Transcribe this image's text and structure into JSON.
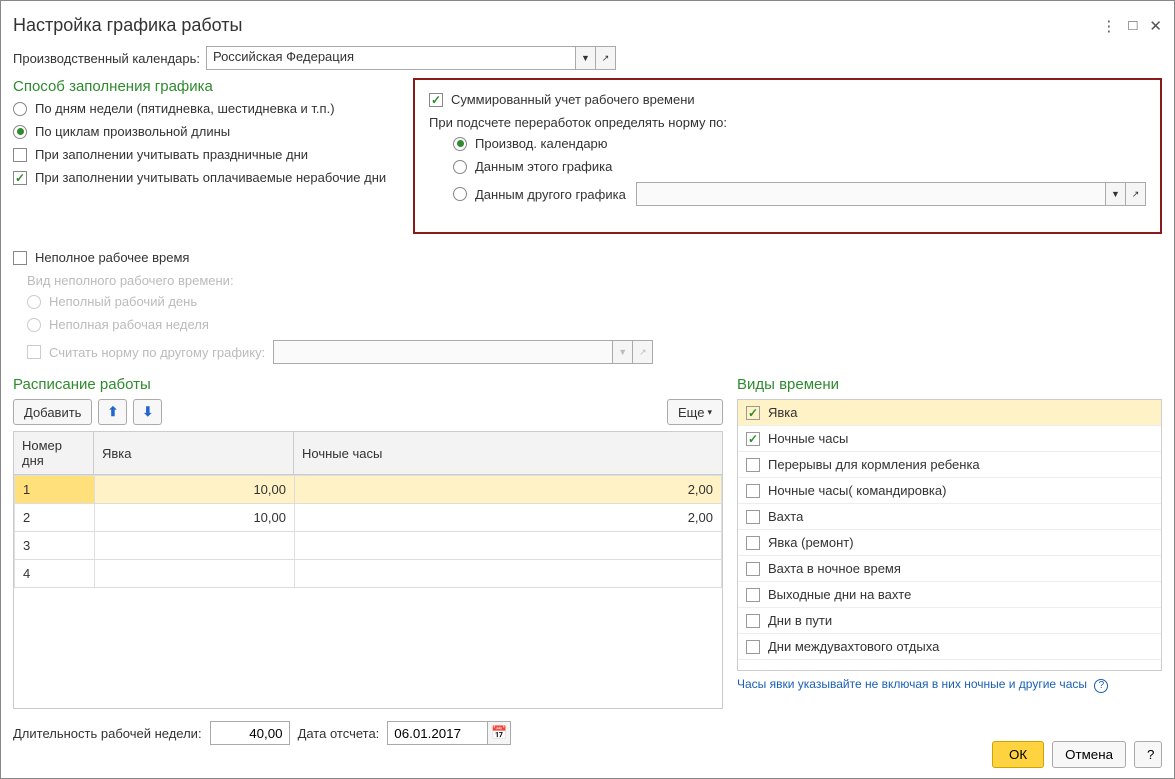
{
  "title": "Настройка графика работы",
  "winbtns": {
    "more": "⋮",
    "max": "□",
    "close": "✕"
  },
  "calendar": {
    "label": "Производственный календарь:",
    "value": "Российская Федерация"
  },
  "fillMethod": {
    "title": "Способ заполнения графика",
    "r1": "По дням недели (пятидневка, шестидневка и т.п.)",
    "r2": "По циклам произвольной длины",
    "c1": "При заполнении учитывать праздничные дни",
    "c2": "При заполнении учитывать оплачиваемые нерабочие дни"
  },
  "summ": {
    "check": "Суммированный учет рабочего времени",
    "normLabel": "При подсчете переработок определять норму по:",
    "r1": "Производ. календарю",
    "r2": "Данным этого графика",
    "r3": "Данным другого графика"
  },
  "partTime": {
    "c1": "Неполное рабочее время",
    "subLabel": "Вид неполного рабочего времени:",
    "r1": "Неполный рабочий день",
    "r2": "Неполная рабочая неделя",
    "c2": "Считать норму по другому графику:"
  },
  "schedule": {
    "title": "Расписание работы",
    "addBtn": "Добавить",
    "moreBtn": "Еще",
    "cols": {
      "dayNum": "Номер дня",
      "att": "Явка",
      "night": "Ночные часы"
    },
    "rows": [
      {
        "n": "1",
        "att": "10,00",
        "night": "2,00"
      },
      {
        "n": "2",
        "att": "10,00",
        "night": "2,00"
      },
      {
        "n": "3",
        "att": "",
        "night": ""
      },
      {
        "n": "4",
        "att": "",
        "night": ""
      }
    ]
  },
  "timeTypes": {
    "title": "Виды времени",
    "items": [
      {
        "label": "Явка",
        "checked": true,
        "selected": true
      },
      {
        "label": "Ночные часы",
        "checked": true
      },
      {
        "label": "Перерывы для кормления ребенка",
        "checked": false
      },
      {
        "label": "Ночные часы( командировка)",
        "checked": false
      },
      {
        "label": "Вахта",
        "checked": false
      },
      {
        "label": "Явка (ремонт)",
        "checked": false
      },
      {
        "label": "Вахта в ночное время",
        "checked": false
      },
      {
        "label": "Выходные дни на вахте",
        "checked": false
      },
      {
        "label": "Дни в пути",
        "checked": false
      },
      {
        "label": "Дни междувахтового отдыха",
        "checked": false
      }
    ],
    "hint": "Часы явки указывайте не включая в них ночные и другие часы"
  },
  "footer": {
    "weekLenLabel": "Длительность рабочей недели:",
    "weekLenVal": "40,00",
    "dateLabel": "Дата отсчета:",
    "dateVal": "06.01.2017"
  },
  "dialog": {
    "ok": "ОК",
    "cancel": "Отмена",
    "help": "?"
  }
}
